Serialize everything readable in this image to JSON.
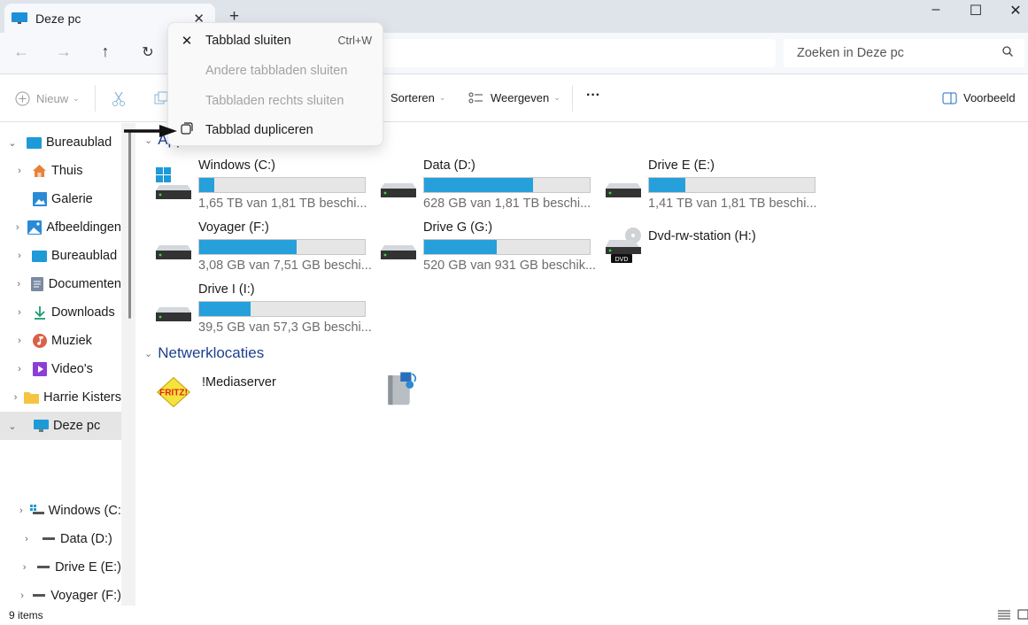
{
  "window": {
    "tab_title": "Deze pc",
    "controls": [
      "minimize",
      "maximize",
      "close"
    ]
  },
  "navigation": {
    "back_icon": "arrow-left-icon",
    "forward_icon": "arrow-right-icon",
    "up_icon": "arrow-up-icon",
    "refresh_icon": "refresh-icon",
    "search_placeholder": "Zoeken in Deze pc"
  },
  "toolbar": {
    "new_label": "Nieuw",
    "sort_label": "Sorteren",
    "view_label": "Weergeven",
    "more_label": "···",
    "preview_label": "Voorbeeld"
  },
  "context_menu": {
    "items": [
      {
        "label": "Tabblad sluiten",
        "shortcut": "Ctrl+W",
        "icon": "close-icon",
        "enabled": true
      },
      {
        "label": "Andere tabbladen sluiten",
        "shortcut": "",
        "icon": "",
        "enabled": false
      },
      {
        "label": "Tabbladen rechts sluiten",
        "shortcut": "",
        "icon": "",
        "enabled": false
      },
      {
        "label": "Tabblad dupliceren",
        "shortcut": "",
        "icon": "duplicate-icon",
        "enabled": true
      }
    ]
  },
  "sidebar": {
    "items": [
      {
        "label": "Bureaublad",
        "expanded": true,
        "level": 0
      },
      {
        "label": "Thuis",
        "level": 1
      },
      {
        "label": "Galerie",
        "level": 1
      },
      {
        "label": "Afbeeldingen",
        "level": 1
      },
      {
        "label": "Bureaublad",
        "level": 1
      },
      {
        "label": "Documenten",
        "level": 1
      },
      {
        "label": "Downloads",
        "level": 1
      },
      {
        "label": "Muziek",
        "level": 1
      },
      {
        "label": "Video's",
        "level": 1
      },
      {
        "label": "Harrie Kisters",
        "level": 1
      },
      {
        "label": "Deze pc",
        "level": 0,
        "expanded": true,
        "selected": true
      },
      {
        "label": "Windows (C:)",
        "level": 2
      },
      {
        "label": "Data (D:)",
        "level": 2
      },
      {
        "label": "Drive E (E:)",
        "level": 2
      },
      {
        "label": "Voyager (F:)",
        "level": 2
      }
    ]
  },
  "content": {
    "drives_group_label": "Apparaten en stations",
    "drives": [
      {
        "name": "Windows (C:)",
        "free_text": "1,65 TB van 1,81 TB beschi...",
        "used_fraction": 0.09,
        "type": "windows"
      },
      {
        "name": "Data (D:)",
        "free_text": "628 GB van 1,81 TB beschi...",
        "used_fraction": 0.66,
        "type": "hdd"
      },
      {
        "name": "Drive E (E:)",
        "free_text": "1,41 TB van 1,81 TB beschi...",
        "used_fraction": 0.22,
        "type": "hdd"
      },
      {
        "name": "Voyager (F:)",
        "free_text": "3,08 GB van 7,51 GB beschi...",
        "used_fraction": 0.59,
        "type": "hdd"
      },
      {
        "name": "Drive G (G:)",
        "free_text": "520 GB van 931 GB beschik...",
        "used_fraction": 0.44,
        "type": "hdd"
      },
      {
        "name": "Dvd-rw-station (H:)",
        "free_text": "",
        "used_fraction": null,
        "type": "dvd",
        "badge": "DVD"
      },
      {
        "name": "Drive I (I:)",
        "free_text": "39,5 GB van 57,3 GB beschi...",
        "used_fraction": 0.31,
        "type": "hdd"
      }
    ],
    "network_group_label": "Netwerklocaties",
    "network": [
      {
        "name": "!Mediaserver",
        "icon": "fritz-icon",
        "logo_text": "FRITZ!"
      },
      {
        "name": "",
        "icon": "media-server-icon"
      }
    ]
  },
  "statusbar": {
    "items_count": "9 items"
  },
  "colors": {
    "accent": "#26a0da",
    "group_header": "#1d3f8f"
  }
}
